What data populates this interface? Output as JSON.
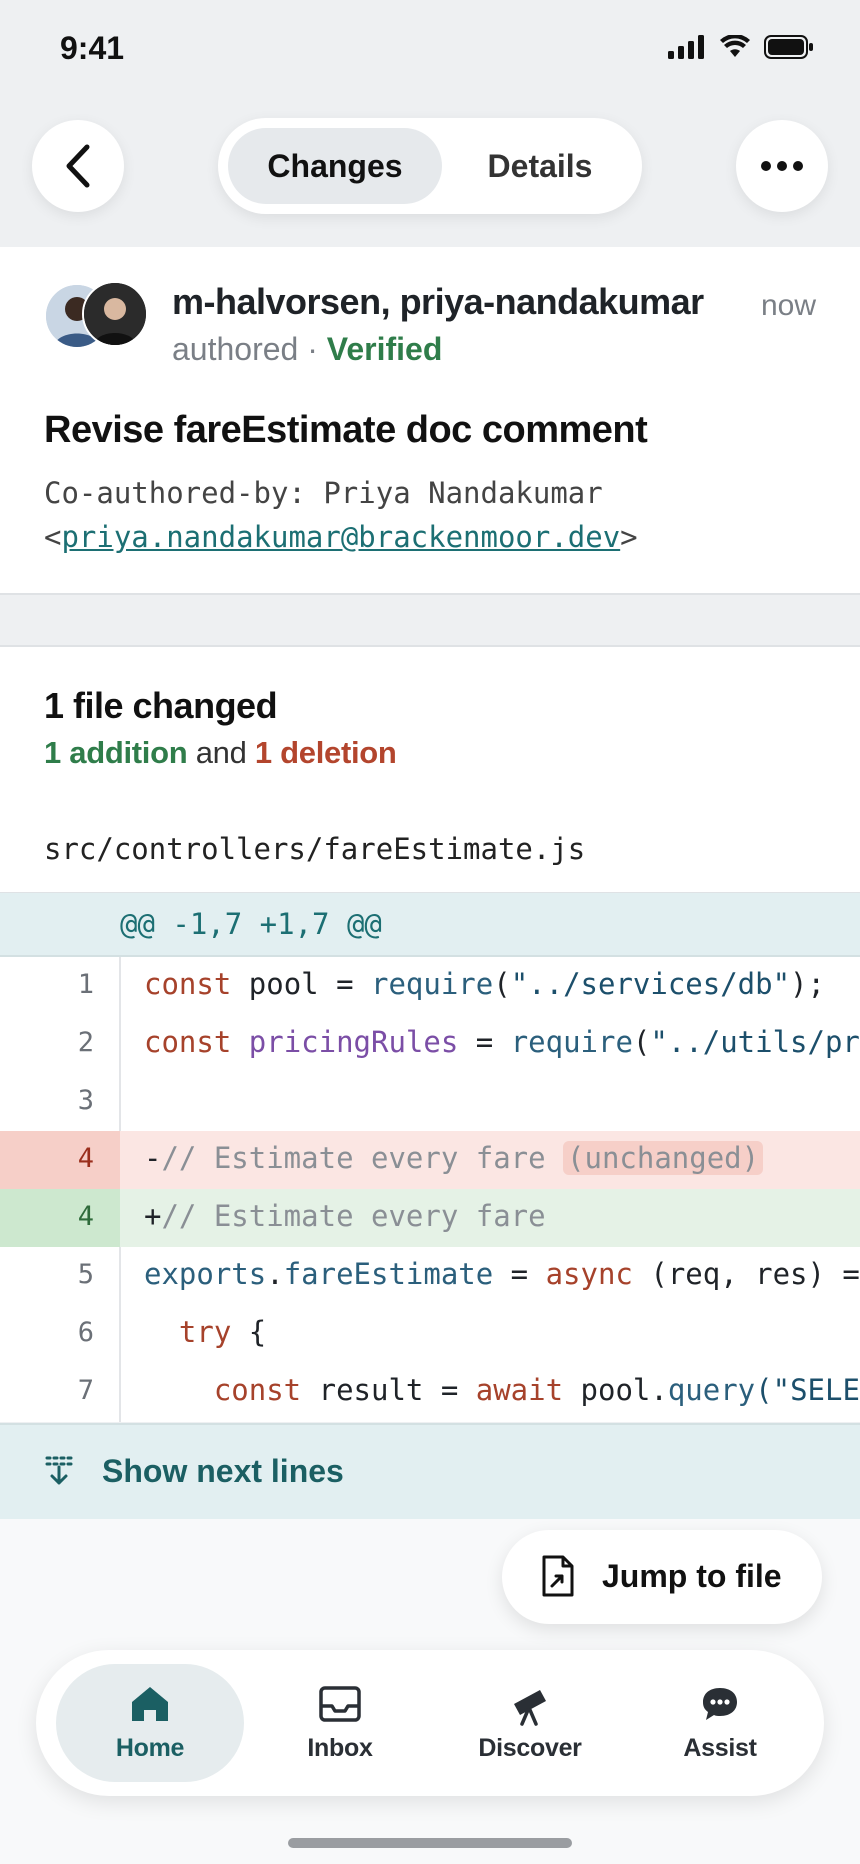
{
  "status_bar": {
    "time": "9:41"
  },
  "nav": {
    "tabs": [
      "Changes",
      "Details"
    ],
    "active_tab": "Changes"
  },
  "commit": {
    "authors": "m-halvorsen, priya-nandakumar",
    "time": "now",
    "authored": "authored",
    "separator": "·",
    "verified": "Verified",
    "title": "Revise fareEstimate doc comment",
    "coauthor_prefix": "Co-authored-by: Priya Nandakumar",
    "coauthor_email": "priya.nandakumar@brackenmoor.dev"
  },
  "files": {
    "title": "1 file changed",
    "additions": "1 addition",
    "and": "and",
    "deletions": "1 deletion",
    "path": "src/controllers/fareEstimate.js"
  },
  "diff": {
    "hunk": "@@ -1,7 +1,7 @@",
    "line_numbers": [
      "1",
      "2",
      "3",
      "4",
      "4",
      "5",
      "6",
      "7"
    ],
    "lines": {
      "l1_kw": "const",
      "l1_a": " pool = ",
      "l1_fn": "require",
      "l1_b": "(",
      "l1_str": "\"../services/db\"",
      "l1_c": ");",
      "l2_kw": "const",
      "l2_prop": "pricingRules",
      "l2_a": " = ",
      "l2_fn": "require",
      "l2_b": "(",
      "l2_str": "\"../utils/pr",
      "l4_sign": "-",
      "l4_cmt": "// Estimate every fare ",
      "l4_hl": "(unchanged)",
      "l5_sign": "+",
      "l5_cmt": "// Estimate every fare",
      "l6_fn": "exports",
      "l6_a": ".",
      "l6_prop": "fareEstimate",
      "l6_b": " = ",
      "l6_kw": "async",
      "l6_c": " (req, res) =",
      "l7_kw": "try",
      "l7_a": " {",
      "l8_kw": "const",
      "l8_a": " result = ",
      "l8_kw2": "await",
      "l8_b": " pool.",
      "l8_fn": "query",
      "l8_str": "(\"SELE"
    }
  },
  "actions": {
    "show_next": "Show next lines",
    "jump_to_file": "Jump to file"
  },
  "tabbar": {
    "items": [
      "Home",
      "Inbox",
      "Discover",
      "Assist"
    ],
    "active": "Home"
  },
  "colors": {
    "accent": "#1b5f63",
    "addition": "#2f7d4a",
    "deletion": "#b3452d"
  }
}
